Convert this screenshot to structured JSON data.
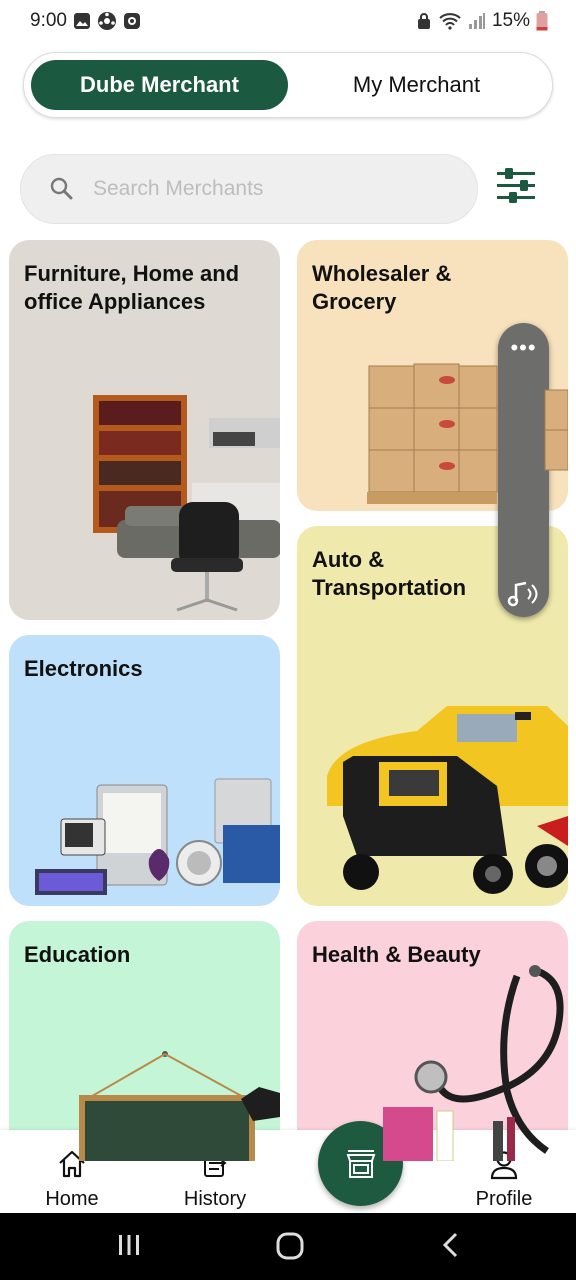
{
  "status_bar": {
    "time": "9:00",
    "battery": "15%"
  },
  "toggle": {
    "active_label": "Dube Merchant",
    "inactive_label": "My Merchant"
  },
  "search": {
    "placeholder": "Search Merchants"
  },
  "categories": [
    {
      "label": "Furniture, Home and office Appliances"
    },
    {
      "label": "Wholesaler & Grocery"
    },
    {
      "label": "Auto & Transportation"
    },
    {
      "label": "Electronics"
    },
    {
      "label": "Education"
    },
    {
      "label": "Health & Beauty"
    }
  ],
  "floating_widget": {
    "dots": "•••"
  },
  "bottom_nav": {
    "home": "Home",
    "history": "History",
    "profile": "Profile"
  },
  "colors": {
    "brand": "#1b5940",
    "search_bg": "#efefef"
  }
}
